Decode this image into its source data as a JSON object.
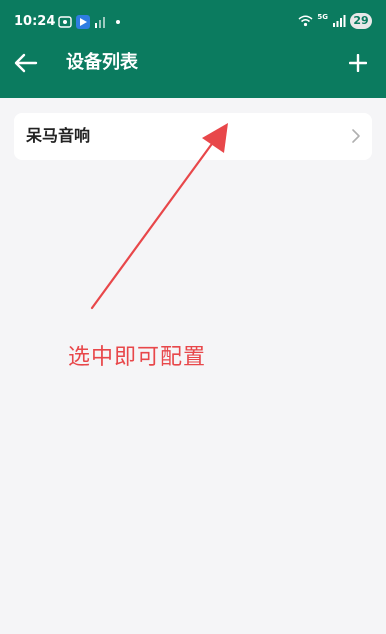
{
  "status_bar": {
    "time": "10:24",
    "battery": "29",
    "network": "5G"
  },
  "nav": {
    "title": "设备列表",
    "back_icon": "arrow-left-icon",
    "add_icon": "plus-icon"
  },
  "devices": [
    {
      "name": "呆马音响"
    }
  ],
  "annotation": {
    "text": "选中即可配置",
    "color": "#e8474a"
  },
  "colors": {
    "header": "#0b7b5f",
    "background": "#f5f5f7"
  }
}
